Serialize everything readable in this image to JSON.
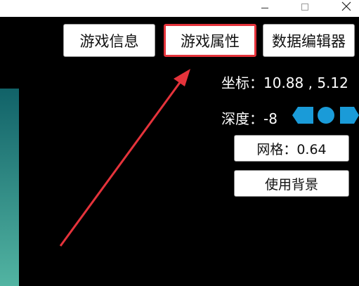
{
  "toolbar": {
    "game_info": "游戏信息",
    "game_attributes": "游戏属性",
    "data_editor": "数据编辑器"
  },
  "properties": {
    "coordinate_text": "坐标：10.88 , 5.12",
    "depth_text": "深度：-8",
    "grid_button": "网格：0.64",
    "background_button": "使用背景"
  },
  "colors": {
    "highlight_border": "#e5333b",
    "annotation_arrow": "#e5333b",
    "panel_gradient_top": "#116268",
    "panel_gradient_bottom": "#52b4a2",
    "depth_icon": "#1a9bd8"
  }
}
